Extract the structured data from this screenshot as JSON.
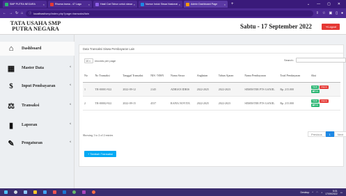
{
  "browser": {
    "tabs": [
      {
        "label": "SMP PUTRA NEGARA",
        "color": "#2bb673"
      },
      {
        "label": "Rhoma Irama - 47 Lagu",
        "color": "#e53935"
      },
      {
        "label": "Hasil Cari Tahun untuk siswa",
        "color": "#8e5fe8"
      },
      {
        "label": "Nomor Induk Siswa Nasional",
        "color": "#1e88e5"
      },
      {
        "label": "Admin Dashboard Page",
        "color": "#ff9800"
      }
    ],
    "url_host": "localhost",
    "url_path": "/smp/index.php?page=transaksi/lain",
    "window_controls": [
      "⌄",
      "—",
      "▢",
      "✕"
    ]
  },
  "header": {
    "brand": "TATA USAHA SMP PUTRA NEGARA",
    "date": "Sabtu - 17 September 2022",
    "logout_label": "Logout"
  },
  "sidebar": {
    "items": [
      {
        "label": "Dashboard",
        "icon": "home-icon",
        "glyph": "⌂",
        "chevron": ""
      },
      {
        "label": "Master Data",
        "icon": "table-icon",
        "glyph": "▦",
        "chevron": "‹"
      },
      {
        "label": "Input Pembayaran",
        "icon": "money-icon",
        "glyph": "$",
        "chevron": "‹"
      },
      {
        "label": "Transaksi",
        "icon": "balance-scale-icon",
        "glyph": "⚖",
        "chevron": "‹"
      },
      {
        "label": "Laporan",
        "icon": "book-icon",
        "glyph": "▮",
        "chevron": "‹"
      },
      {
        "label": "Pengaturan",
        "icon": "wrench-icon",
        "glyph": "✎",
        "chevron": "‹"
      }
    ]
  },
  "main": {
    "card_title": "Data Transaksi Siswa Pembayaran Lain",
    "length_prefix": "",
    "length_value": "10",
    "length_suffix": "records per page",
    "search_label": "Search:",
    "search_value": "",
    "table": {
      "headers": [
        "No",
        "No Transaksi",
        "Tanggal Transaksi",
        "NIS / NISN",
        "Nama Siswa",
        "Angkatan",
        "Tahun Ajaran",
        "Nama Pembayaran",
        "Total Pembayaran",
        "Aksi"
      ],
      "rows": [
        [
          "1",
          "TR-00001-922",
          "2022-09-12",
          "2145",
          "ADRIAN IDRIS",
          "2022-2025",
          "2022-2023",
          "SEMESTER PTS GANJIL",
          "Rp. 215.000"
        ],
        [
          "2",
          "TR-00002-922",
          "2022-09-15",
          "4537",
          "RAFIA NOVITA",
          "2022-2025",
          "2022-2023",
          "SEMESTER PTS GANJIL",
          "Rp. 215.000"
        ]
      ],
      "actions": {
        "edit": "Edit",
        "hapus": "Hapus",
        "print": "Print"
      }
    },
    "info": "Showing 1 to 2 of 2 entries",
    "pagination": {
      "previous": "Previous",
      "current": "1",
      "next": "Next"
    },
    "add_button": "+ Tambah Transaksi"
  },
  "taskbar": {
    "tray_text": "Desktop",
    "time": "5:01",
    "date": "17/09/2022"
  }
}
